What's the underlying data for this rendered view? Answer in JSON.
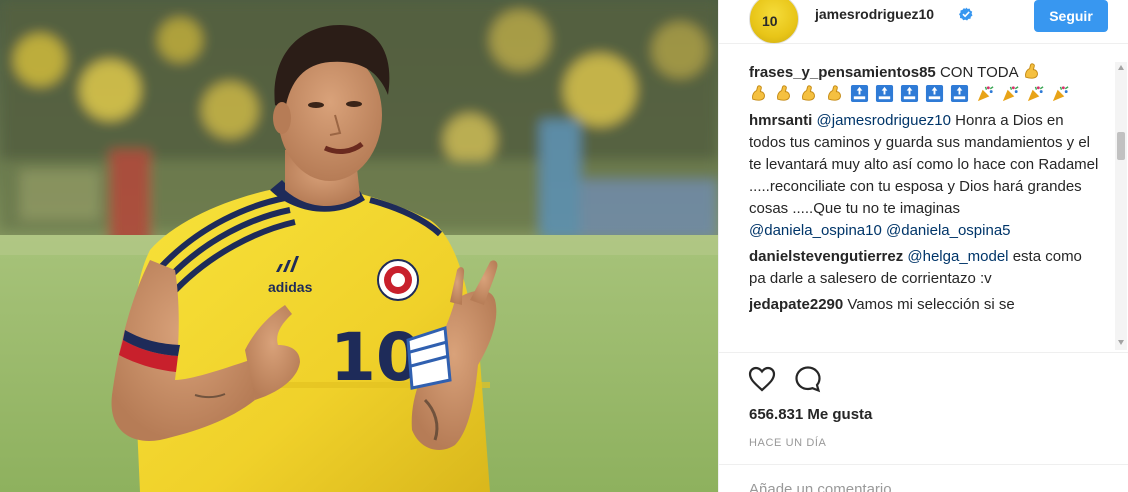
{
  "header": {
    "username": "jamesrodriguez10",
    "follow_label": "Seguir",
    "avatar_number": "10"
  },
  "photo": {
    "jersey_number": "10",
    "brand": "adidas"
  },
  "comments": [
    {
      "user": "frases_y_pensamientos85",
      "text": "CON TODA",
      "emojis": [
        "flexed-biceps-icon",
        "flexed-biceps-icon",
        "flexed-biceps-icon",
        "flexed-biceps-icon",
        "flexed-biceps-icon",
        "top-arrow-icon",
        "top-arrow-icon",
        "top-arrow-icon",
        "top-arrow-icon",
        "top-arrow-icon",
        "party-popper-icon",
        "party-popper-icon",
        "party-popper-icon",
        "party-popper-icon"
      ]
    },
    {
      "user": "hmrsanti",
      "mention": "@jamesrodriguez10",
      "text": "Honra a Dios en todos tus caminos y guarda sus mandamientos y el te levantará muy alto así como lo hace con Radamel .....reconciliate con tu esposa y Dios hará grandes cosas .....Que tu no te imaginas",
      "mentions_after": [
        "@daniela_ospina10",
        "@daniela_ospina5"
      ]
    },
    {
      "user": "danielstevengutierrez",
      "mention": "@helga_model",
      "text": "esta como pa darle a salesero de corrientazo :v"
    },
    {
      "user": "jedapate2290",
      "text": "Vamos mi selección si se"
    }
  ],
  "likes": "656.831 Me gusta",
  "timestamp": "HACE UN DÍA",
  "comment_input": {
    "placeholder": "Añade un comentario..."
  },
  "colors": {
    "follow_button": "#3897f0",
    "verified_badge": "#3897f0",
    "mention": "#003569",
    "jersey_yellow": "#f2d72a"
  }
}
